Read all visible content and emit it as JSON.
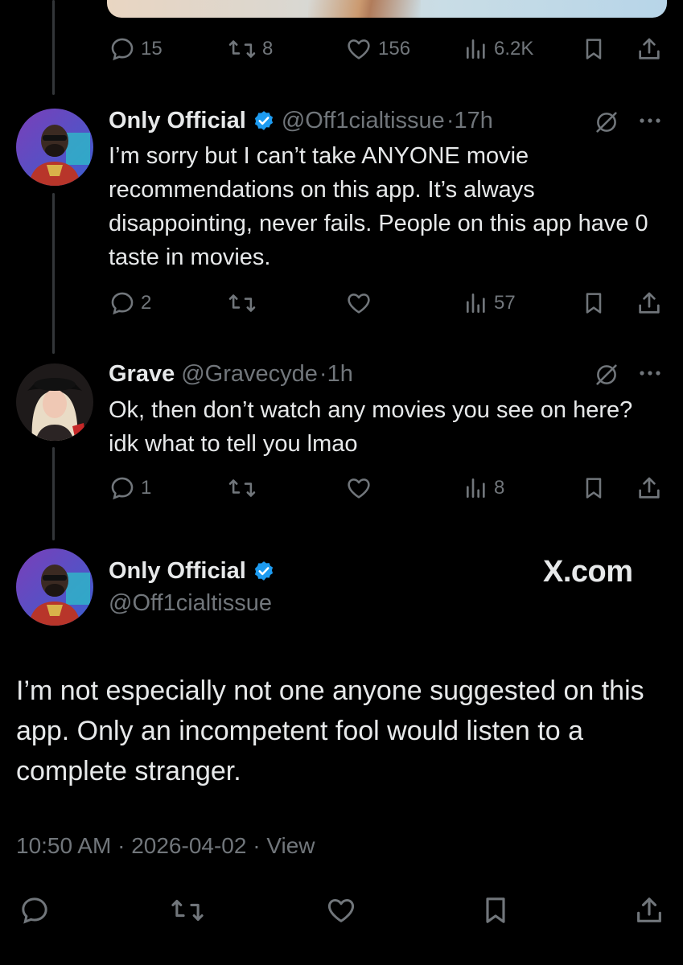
{
  "top_tweet": {
    "reply_count": "15",
    "retweet_count": "8",
    "like_count": "156",
    "views": "6.2K"
  },
  "tweet1": {
    "name": "Only Official",
    "handle": "@Off1cialtissue",
    "time": "·17h",
    "text": "I’m sorry but I can’t take ANYONE movie recommendations on this app. It’s always disappointing, never fails. People on this app have 0 taste in movies.",
    "reply_count": "2",
    "views": "57"
  },
  "tweet2": {
    "name": "Grave",
    "handle": "@Gravecyde",
    "time": "·1h",
    "text": "Ok, then don’t watch any movies you see on here? idk what to tell you lmao",
    "reply_count": "1",
    "views": "8"
  },
  "main_tweet": {
    "name": "Only Official",
    "handle": "@Off1cialtissue",
    "watermark": "X.com",
    "text": "I’m not especially not one anyone suggested on this app. Only an incompetent fool would listen to a complete stranger.",
    "timestamp": "10:50 AM",
    "date": "2026-04-02",
    "views_label": "View",
    "separator": "·"
  },
  "colors": {
    "background": "#000000",
    "text": "#e7e9ea",
    "muted": "#71767b",
    "verified": "#1d9bf0",
    "line": "#333639"
  }
}
